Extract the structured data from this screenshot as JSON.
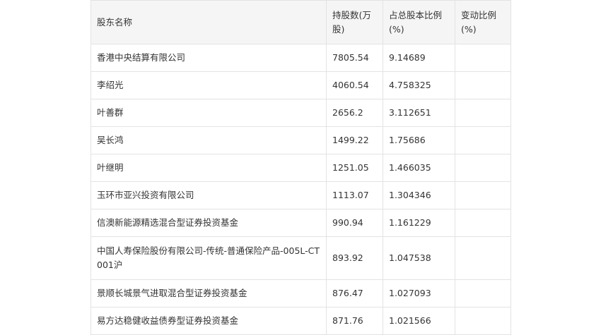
{
  "table": {
    "headers": [
      "股东名称",
      "持股数(万股)",
      "占总股本比例(%)",
      "变动比例(%)"
    ],
    "rows": [
      {
        "name": "香港中央结算有限公司",
        "shares": "7805.54",
        "ratio": "9.14689",
        "change": ""
      },
      {
        "name": "李绍光",
        "shares": "4060.54",
        "ratio": "4.758325",
        "change": ""
      },
      {
        "name": "叶善群",
        "shares": "2656.2",
        "ratio": "3.112651",
        "change": ""
      },
      {
        "name": "吴长鸿",
        "shares": "1499.22",
        "ratio": "1.75686",
        "change": ""
      },
      {
        "name": "叶继明",
        "shares": "1251.05",
        "ratio": "1.466035",
        "change": ""
      },
      {
        "name": "玉环市亚兴投资有限公司",
        "shares": "1113.07",
        "ratio": "1.304346",
        "change": ""
      },
      {
        "name": "信澳新能源精选混合型证券投资基金",
        "shares": "990.94",
        "ratio": "1.161229",
        "change": ""
      },
      {
        "name": "中国人寿保险股份有限公司-传统-普通保险产品-005L-CT001沪",
        "shares": "893.92",
        "ratio": "1.047538",
        "change": ""
      },
      {
        "name": "景顺长城景气进取混合型证券投资基金",
        "shares": "876.47",
        "ratio": "1.027093",
        "change": ""
      },
      {
        "name": "易方达稳健收益债券型证券投资基金",
        "shares": "871.76",
        "ratio": "1.021566",
        "change": ""
      }
    ]
  }
}
